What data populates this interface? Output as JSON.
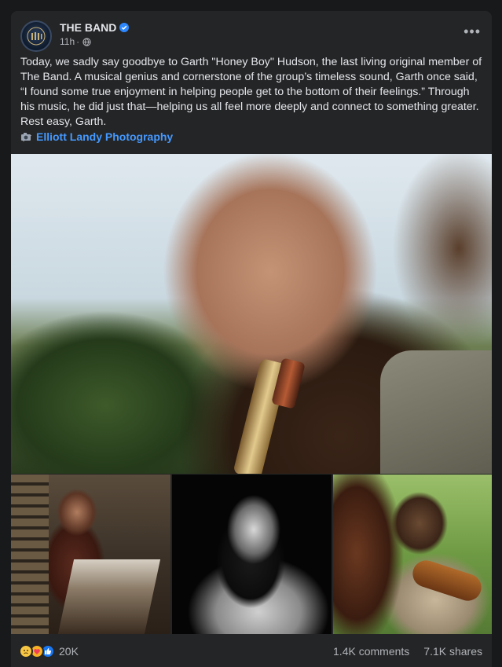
{
  "post": {
    "page_name": "THE BAND",
    "timestamp": "11h",
    "more_label": "•••",
    "text": "Today, we sadly say goodbye to Garth \"Honey Boy\" Hudson, the last living original member of The Band. A musical genius and cornerstone of the group’s timeless sound, Garth once said, “I found some true enjoyment in helping people get to the bottom of their feelings.” Through his music, he did just that—helping us all feel more deeply and connect to something greater. Rest easy, Garth.",
    "dove_icon": "dove-icon",
    "photo_credit": "Elliott Landy Photography",
    "photo_credit_icon": "camera-icon"
  },
  "footer": {
    "reaction_icons": [
      "sad-icon",
      "care-icon",
      "like-icon"
    ],
    "reaction_count": "20K",
    "comments": "1.4K comments",
    "shares": "7.1K shares"
  },
  "colors": {
    "background": "#18191a",
    "card": "#242526",
    "text": "#e4e6eb",
    "muted": "#b0b3b8",
    "link": "#4599ff",
    "verified": "#2d88ff"
  }
}
